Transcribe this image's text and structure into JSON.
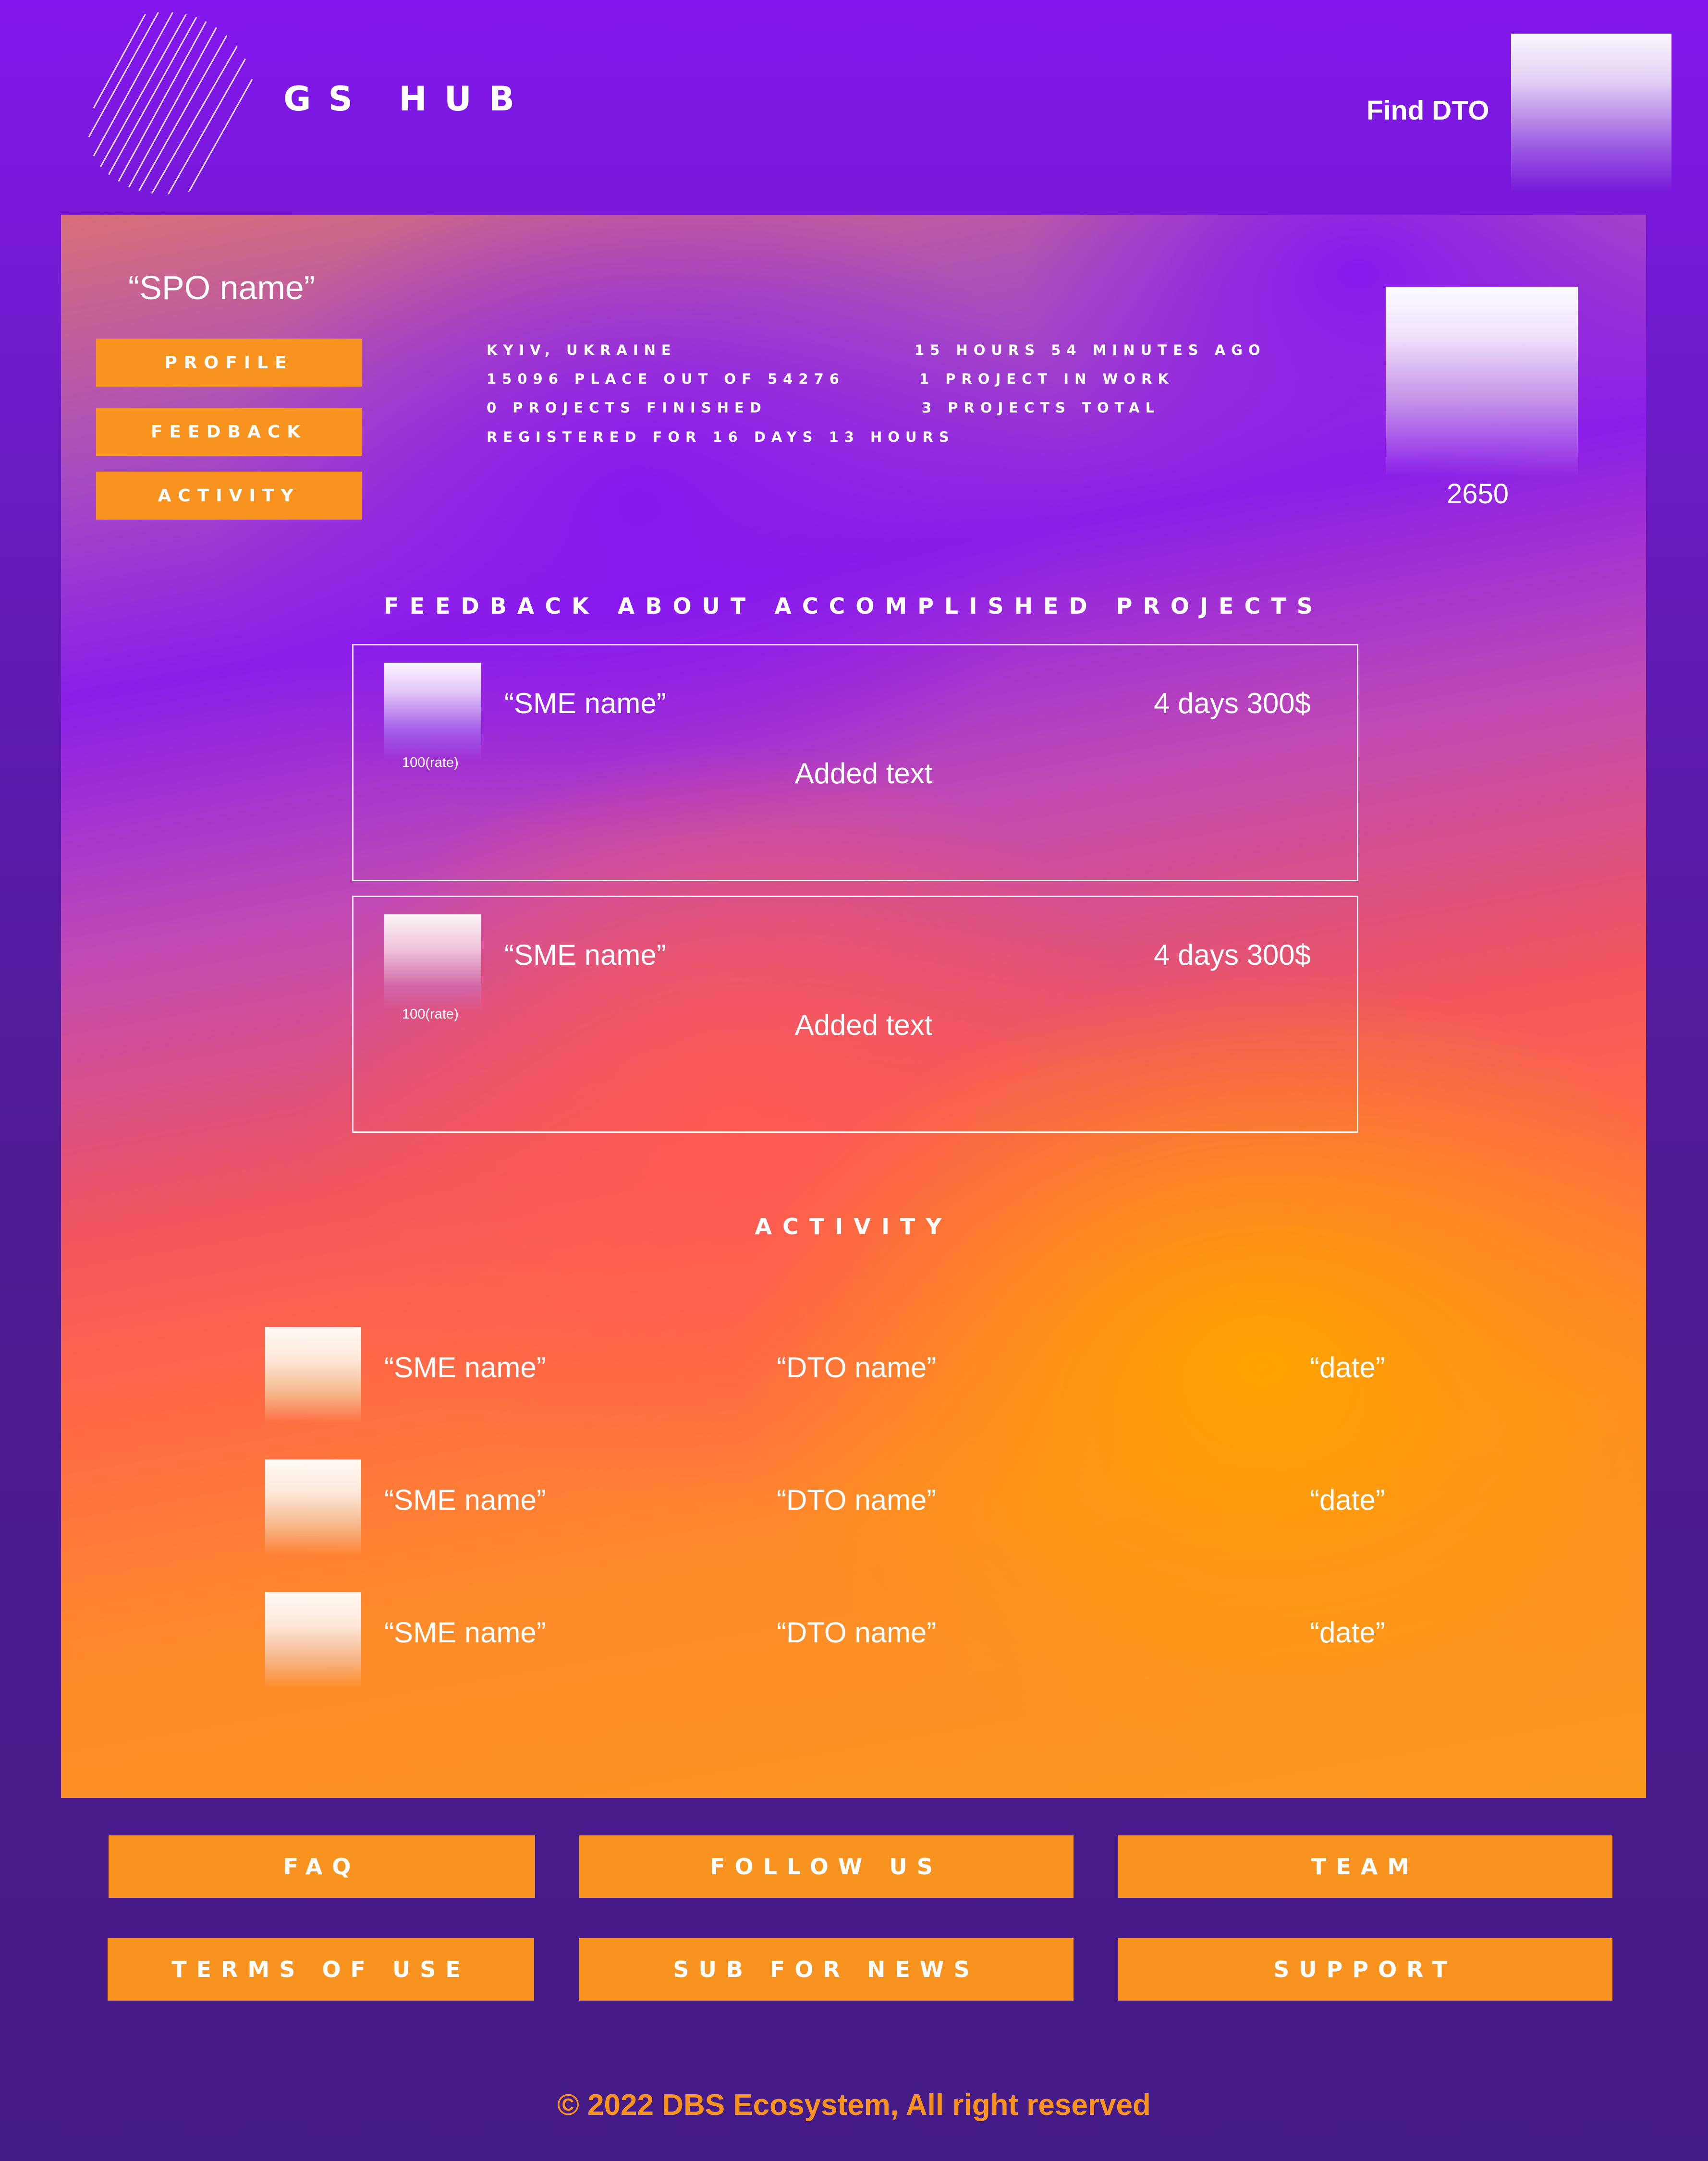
{
  "header": {
    "brand": "GS HUB",
    "find_link": "Find DTO",
    "logo_icon": "striped-circle-logo"
  },
  "profile": {
    "spo_name": "“SPO name”",
    "nav": [
      "PROFILE",
      "FEEDBACK",
      "ACTIVITY"
    ],
    "stats_left": [
      "KYIV, UKRAINE",
      "15096 PLACE OUT OF 54276",
      "0 PROJECTS FINISHED",
      "REGISTERED FOR 16 DAYS 13 HOURS"
    ],
    "stats_right": [
      "15 HOURS 54 MINUTES AGO",
      "1 PROJECT IN WORK",
      "3 PROJECTS TOTAL"
    ],
    "score": "2650"
  },
  "feedback": {
    "title": "FEEDBACK ABOUT ACCOMPLISHED PROJECTS",
    "items": [
      {
        "name": "“SME name”",
        "meta": "4 days 300$",
        "rate": "100(rate)",
        "text": "Added text"
      },
      {
        "name": "“SME name”",
        "meta": "4 days 300$",
        "rate": "100(rate)",
        "text": "Added text"
      }
    ]
  },
  "activity": {
    "title": "ACTIVITY",
    "rows": [
      {
        "sme": "“SME name”",
        "dto": "“DTO name”",
        "date": "“date”"
      },
      {
        "sme": "“SME name”",
        "dto": "“DTO name”",
        "date": "“date”"
      },
      {
        "sme": "“SME name”",
        "dto": "“DTO name”",
        "date": "“date”"
      }
    ]
  },
  "footer": {
    "links": [
      "FAQ",
      "FOLLOW US",
      "TEAM",
      "TERMS OF USE",
      "SUB FOR NEWS",
      "SUPPORT"
    ],
    "copyright": "© 2022 DBS Ecosystem, All right reserved"
  },
  "colors": {
    "accent": "#f7931e",
    "header_bg": "#8316ec",
    "footer_bg": "#431b86"
  }
}
